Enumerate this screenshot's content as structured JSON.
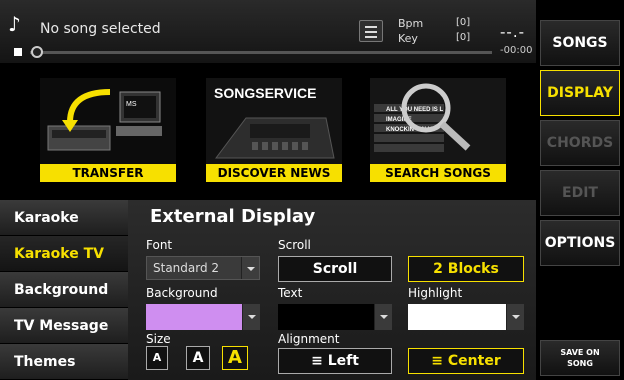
{
  "topbar": {
    "song_title": "No song selected",
    "bpm_label": "Bpm",
    "bpm_value": "[0]",
    "key_label": "Key",
    "key_value": "[0]",
    "time_display": "--.-",
    "time_remaining": "-00:00"
  },
  "banner": {
    "tiles": [
      {
        "label": "TRANSFER",
        "icon": "transfer-icon"
      },
      {
        "label": "DISCOVER NEWS",
        "icon": "songservice-icon",
        "logo_text": "SONGSERVICE"
      },
      {
        "label": "SEARCH SONGS",
        "icon": "magnifier-icon",
        "list_items": [
          "ALL YOU NEED IS L",
          "IMAGINE",
          "KNOCKIN' ON H"
        ]
      }
    ]
  },
  "sidebar": {
    "items": [
      {
        "label": "Karaoke",
        "active": false
      },
      {
        "label": "Karaoke TV",
        "active": true
      },
      {
        "label": "Background TV",
        "active": false
      },
      {
        "label": "TV Message",
        "active": false
      },
      {
        "label": "Themes",
        "active": false
      }
    ]
  },
  "panel": {
    "title": "External Display",
    "font_label": "Font",
    "font_value": "Standard 2",
    "scroll_label": "Scroll",
    "scroll_button": "Scroll",
    "blocks_button": "2 Blocks",
    "background_label": "Background",
    "background_color": "#cf8ef0",
    "text_label": "Text",
    "text_color": "#000000",
    "highlight_label": "Highlight",
    "highlight_color": "#ffffff",
    "size_label": "Size",
    "size_buttons": [
      "A",
      "A",
      "A"
    ],
    "alignment_label": "Alignment",
    "align_left": "Left",
    "align_center": "Center"
  },
  "rightcol": {
    "songs": "SONGS",
    "display": "DISPLAY",
    "chords": "CHORDS",
    "edit": "EDIT",
    "options": "OPTIONS",
    "save_line1": "SAVE ON",
    "save_line2": "SONG"
  },
  "colors": {
    "accent": "#f7e000"
  }
}
